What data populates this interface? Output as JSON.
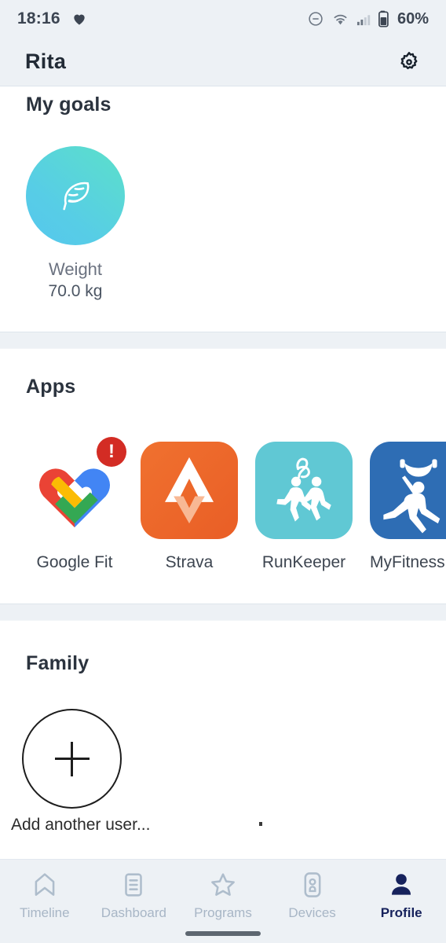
{
  "status_bar": {
    "time": "18:16",
    "heart_icon": "heart-icon",
    "dnd_icon": "do-not-disturb-icon",
    "wifi_icon": "wifi-icon",
    "signal_icon": "cellular-signal-icon",
    "battery_icon": "battery-icon",
    "battery_text": "60%"
  },
  "header": {
    "title": "Rita",
    "settings_icon": "gear-icon"
  },
  "goals": {
    "title": "My goals",
    "items": [
      {
        "icon": "feather-icon",
        "label": "Weight",
        "value": "70.0 kg",
        "gradient_from": "#56c7ed",
        "gradient_to": "#5ce0c9"
      }
    ]
  },
  "apps": {
    "title": "Apps",
    "items": [
      {
        "name": "Google Fit",
        "icon": "google-fit-icon",
        "badge": "!",
        "badge_color": "#d32c24",
        "tile_color": "#ffffff"
      },
      {
        "name": "Strava",
        "icon": "strava-icon",
        "badge": null,
        "tile_color": "#ed6b30"
      },
      {
        "name": "RunKeeper",
        "icon": "runkeeper-icon",
        "badge": null,
        "tile_color": "#60c8d4"
      },
      {
        "name": "MyFitnessPal",
        "icon": "myfitnesspal-icon",
        "badge": null,
        "tile_color": "#2e6db4"
      }
    ],
    "truncated_last_label": "MyFitness"
  },
  "family": {
    "title": "Family",
    "add_user_label": "Add another user...",
    "add_icon": "plus-icon"
  },
  "bottom_nav": {
    "items": [
      {
        "label": "Timeline",
        "icon": "timeline-icon",
        "active": false
      },
      {
        "label": "Dashboard",
        "icon": "dashboard-icon",
        "active": false
      },
      {
        "label": "Programs",
        "icon": "star-icon",
        "active": false
      },
      {
        "label": "Devices",
        "icon": "watch-icon",
        "active": false
      },
      {
        "label": "Profile",
        "icon": "person-icon",
        "active": true
      }
    ],
    "active_color": "#16225c",
    "inactive_color": "#a8b6c6"
  }
}
